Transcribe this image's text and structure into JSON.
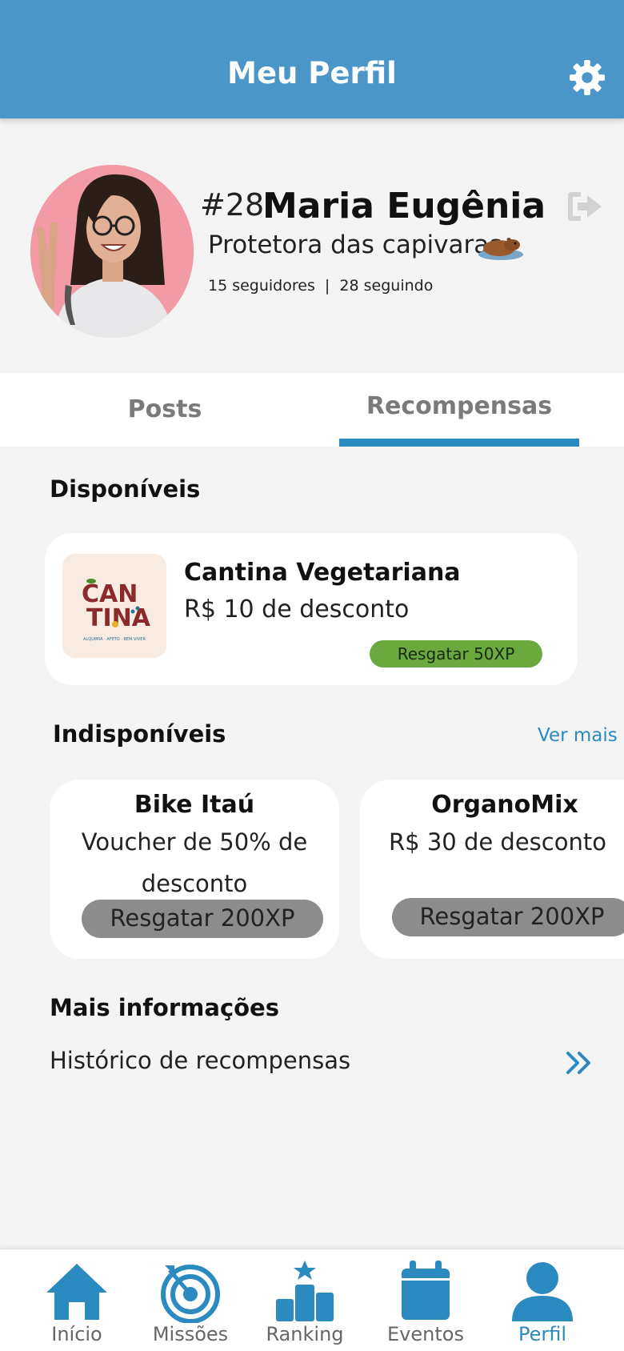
{
  "header": {
    "title": "Meu Perfil"
  },
  "profile": {
    "rank": "#28",
    "name": "Maria Eugênia",
    "bio": "Protetora das capivaras",
    "stats": "15 seguidores  |  28 seguindo"
  },
  "tabs": [
    {
      "label": "Posts",
      "active": false
    },
    {
      "label": "Recompensas",
      "active": true
    }
  ],
  "available": {
    "section_title": "Disponíveis",
    "items": [
      {
        "title": "Cantina Vegetariana",
        "description": "R$ 10 de desconto",
        "button": "Resgatar 50XP",
        "logo_text": {
          "line1": "CAN",
          "line2": "TINA",
          "tagline": "ALQUIMIA · AFETO · BEM VIVER"
        }
      }
    ]
  },
  "unavailable": {
    "section_title": "Indisponíveis",
    "see_more": "Ver mais",
    "items": [
      {
        "title": "Bike Itaú",
        "description": "Voucher de 50% de desconto",
        "button": "Resgatar 200XP"
      },
      {
        "title": "OrganoMix",
        "description": "R$ 30 de desconto",
        "button": "Resgatar 200XP"
      }
    ]
  },
  "more_info": {
    "section_title": "Mais informações",
    "history": "Histórico de recompensas"
  },
  "nav": [
    {
      "label": "Início",
      "icon": "home-icon",
      "active": false
    },
    {
      "label": "Missões",
      "icon": "target-icon",
      "active": false
    },
    {
      "label": "Ranking",
      "icon": "podium-icon",
      "active": false
    },
    {
      "label": "Eventos",
      "icon": "calendar-icon",
      "active": false
    },
    {
      "label": "Perfil",
      "icon": "person-icon",
      "active": true
    }
  ],
  "colors": {
    "header": "#4b96c8",
    "accent": "#2b8ac0",
    "available_button": "#6aa93d",
    "unavailable_button": "#8c8c8c",
    "background": "#f4f4f5"
  }
}
